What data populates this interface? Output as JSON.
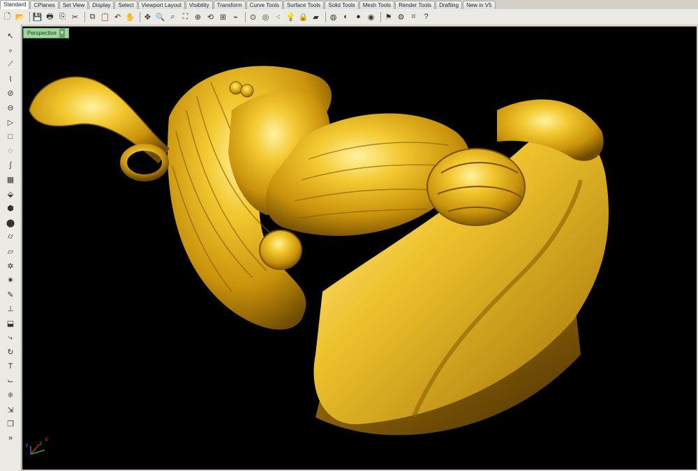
{
  "tabs": [
    "Standard",
    "CPlanes",
    "Set View",
    "Display",
    "Select",
    "Viewport Layout",
    "Visibility",
    "Transform",
    "Curve Tools",
    "Surface Tools",
    "Solid Tools",
    "Mesh Tools",
    "Render Tools",
    "Drafting",
    "New in V5"
  ],
  "active_tab": "Standard",
  "toolbar": {
    "icons": [
      {
        "name": "new-icon",
        "glyph": "🗋"
      },
      {
        "name": "open-icon",
        "glyph": "📂"
      },
      {
        "name": "save-icon",
        "glyph": "💾"
      },
      {
        "name": "print-icon",
        "glyph": "🖶"
      },
      {
        "name": "import-icon",
        "glyph": "⎘"
      },
      {
        "name": "cut-icon",
        "glyph": "✂"
      },
      {
        "name": "copy-icon",
        "glyph": "⧉"
      },
      {
        "name": "paste-icon",
        "glyph": "📋"
      },
      {
        "name": "undo-icon",
        "glyph": "↶"
      },
      {
        "name": "pan-icon",
        "glyph": "✋"
      },
      {
        "name": "rotate-view-icon",
        "glyph": "✥"
      },
      {
        "name": "zoom-icon",
        "glyph": "🔍"
      },
      {
        "name": "zoom-window-icon",
        "glyph": "⌕"
      },
      {
        "name": "zoom-extents-icon",
        "glyph": "⛶"
      },
      {
        "name": "zoom-selected-icon",
        "glyph": "⊕"
      },
      {
        "name": "undo-view-icon",
        "glyph": "⟲"
      },
      {
        "name": "viewport-layout-icon",
        "glyph": "⊞"
      },
      {
        "name": "cplane-icon",
        "glyph": "⌁"
      },
      {
        "name": "snap-icon",
        "glyph": "⊙"
      },
      {
        "name": "osnap-icon",
        "glyph": "◎"
      },
      {
        "name": "points-icon",
        "glyph": "⁖"
      },
      {
        "name": "light-icon",
        "glyph": "💡"
      },
      {
        "name": "lock-icon",
        "glyph": "🔒"
      },
      {
        "name": "layer-icon",
        "glyph": "▰"
      },
      {
        "name": "color-icon",
        "glyph": "◍"
      },
      {
        "name": "shaded-icon",
        "glyph": "◐"
      },
      {
        "name": "rendered-icon",
        "glyph": "●"
      },
      {
        "name": "render-icon",
        "glyph": "◉"
      },
      {
        "name": "tag-icon",
        "glyph": "⚑"
      },
      {
        "name": "settings-icon",
        "glyph": "⚙"
      },
      {
        "name": "options-icon",
        "glyph": "⌗"
      },
      {
        "name": "help-icon",
        "glyph": "?"
      }
    ]
  },
  "sidebar": {
    "icons": [
      {
        "name": "select-arrow-icon",
        "glyph": "↖"
      },
      {
        "name": "point-icon",
        "glyph": "∘"
      },
      {
        "name": "polyline-icon",
        "glyph": "⟋"
      },
      {
        "name": "curve-points-icon",
        "glyph": "⌇"
      },
      {
        "name": "circle-icon",
        "glyph": "⊘"
      },
      {
        "name": "ellipse-icon",
        "glyph": "⊖"
      },
      {
        "name": "polygon-icon",
        "glyph": "▷"
      },
      {
        "name": "rectangle-icon",
        "glyph": "□"
      },
      {
        "name": "arc-icon",
        "glyph": "◌"
      },
      {
        "name": "freeform-curve-icon",
        "glyph": "∫"
      },
      {
        "name": "surface-icon",
        "glyph": "▦"
      },
      {
        "name": "extrude-icon",
        "glyph": "⬙"
      },
      {
        "name": "box-icon",
        "glyph": "⬢"
      },
      {
        "name": "sphere-icon",
        "glyph": "⬤"
      },
      {
        "name": "cylinder-icon",
        "glyph": "⌭"
      },
      {
        "name": "mesh-icon",
        "glyph": "▱"
      },
      {
        "name": "boolean-icon",
        "glyph": "✲"
      },
      {
        "name": "explode-icon",
        "glyph": "✷"
      },
      {
        "name": "trim-icon",
        "glyph": "✎"
      },
      {
        "name": "split-icon",
        "glyph": "⊥"
      },
      {
        "name": "fillet-icon",
        "glyph": "⬓"
      },
      {
        "name": "move-icon",
        "glyph": "⤷"
      },
      {
        "name": "rotate-icon",
        "glyph": "↻"
      },
      {
        "name": "text-icon",
        "glyph": "T"
      },
      {
        "name": "dimension-icon",
        "glyph": "⌙"
      },
      {
        "name": "array-icon",
        "glyph": "⁜"
      },
      {
        "name": "analyze-icon",
        "glyph": "⇲"
      },
      {
        "name": "render-cube-icon",
        "glyph": "❒"
      },
      {
        "name": "expand-icon",
        "glyph": "»"
      }
    ]
  },
  "viewport": {
    "name": "Perspective"
  },
  "axes": {
    "x": "x",
    "y": "y",
    "z": "z"
  },
  "colors": {
    "viewport_bg": "#000000",
    "model_gold": "#d9a911",
    "label_green": "#9fd69a"
  }
}
